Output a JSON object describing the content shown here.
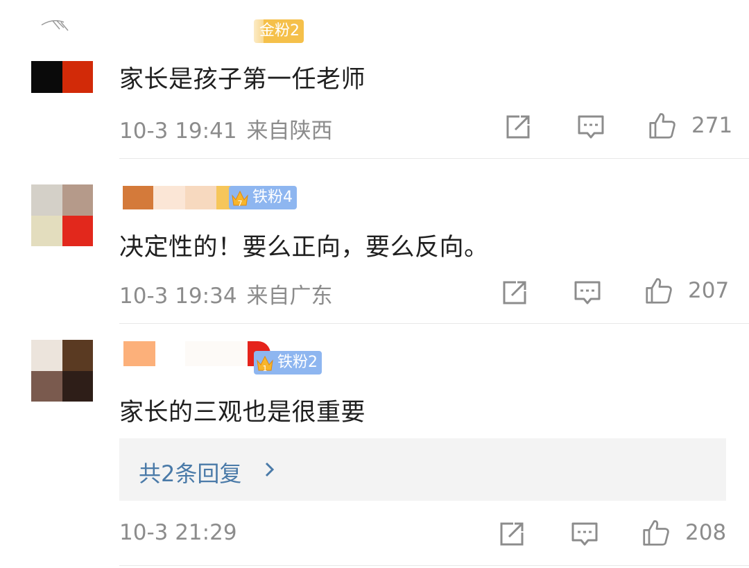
{
  "colors": {
    "text": "#1f1f1f",
    "meta": "#8c8c8c",
    "link": "#4a7aa8",
    "badge_gold": "#f5c04a",
    "badge_blue": "#8eb6f0"
  },
  "comments": [
    {
      "badge": "金粉2",
      "text": "家长是孩子第一任老师",
      "time": "10-3 19:41",
      "location": "来自陕西",
      "likes": "271",
      "icons": [
        "share-icon",
        "comment-icon",
        "like-icon"
      ]
    },
    {
      "badge": "铁粉4",
      "text": "决定性的！要么正向，要么反向。",
      "time": "10-3 19:34",
      "location": "来自广东",
      "likes": "207",
      "icons": [
        "share-icon",
        "comment-icon",
        "like-icon"
      ]
    },
    {
      "badge": "铁粉2",
      "text": "家长的三观也是很重要",
      "replies_label": "共2条回复",
      "time": "10-3 21:29",
      "likes": "208",
      "icons": [
        "share-icon",
        "comment-icon",
        "like-icon"
      ]
    }
  ]
}
